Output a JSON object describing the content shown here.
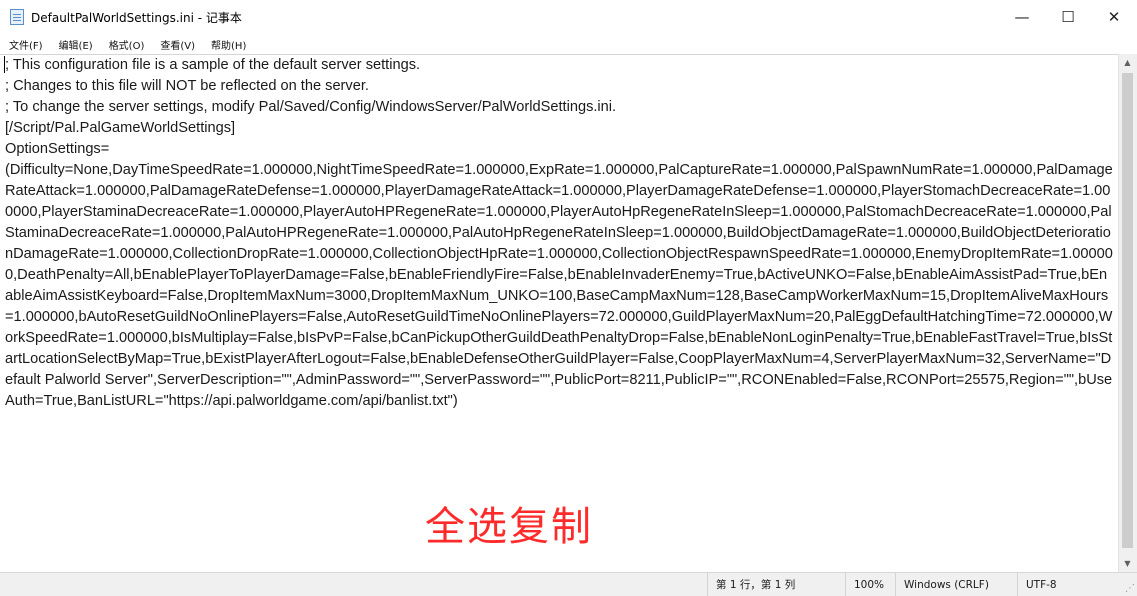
{
  "window": {
    "title": "DefaultPalWorldSettings.ini - 记事本",
    "app_icon": "notepad-icon",
    "controls": {
      "minimize": "—",
      "maximize": "☐",
      "close": "✕"
    }
  },
  "menu": {
    "items": [
      "文件(F)",
      "编辑(E)",
      "格式(O)",
      "查看(V)",
      "帮助(H)"
    ]
  },
  "editor": {
    "content": "; This configuration file is a sample of the default server settings.\n; Changes to this file will NOT be reflected on the server.\n; To change the server settings, modify Pal/Saved/Config/WindowsServer/PalWorldSettings.ini.\n[/Script/Pal.PalGameWorldSettings]\nOptionSettings=\n(Difficulty=None,DayTimeSpeedRate=1.000000,NightTimeSpeedRate=1.000000,ExpRate=1.000000,PalCaptureRate=1.000000,PalSpawnNumRate=1.000000,PalDamageRateAttack=1.000000,PalDamageRateDefense=1.000000,PlayerDamageRateAttack=1.000000,PlayerDamageRateDefense=1.000000,PlayerStomachDecreaceRate=1.000000,PlayerStaminaDecreaceRate=1.000000,PlayerAutoHPRegeneRate=1.000000,PlayerAutoHpRegeneRateInSleep=1.000000,PalStomachDecreaceRate=1.000000,PalStaminaDecreaceRate=1.000000,PalAutoHPRegeneRate=1.000000,PalAutoHpRegeneRateInSleep=1.000000,BuildObjectDamageRate=1.000000,BuildObjectDeteriorationDamageRate=1.000000,CollectionDropRate=1.000000,CollectionObjectHpRate=1.000000,CollectionObjectRespawnSpeedRate=1.000000,EnemyDropItemRate=1.000000,DeathPenalty=All,bEnablePlayerToPlayerDamage=False,bEnableFriendlyFire=False,bEnableInvaderEnemy=True,bActiveUNKO=False,bEnableAimAssistPad=True,bEnableAimAssistKeyboard=False,DropItemMaxNum=3000,DropItemMaxNum_UNKO=100,BaseCampMaxNum=128,BaseCampWorkerMaxNum=15,DropItemAliveMaxHours=1.000000,bAutoResetGuildNoOnlinePlayers=False,AutoResetGuildTimeNoOnlinePlayers=72.000000,GuildPlayerMaxNum=20,PalEggDefaultHatchingTime=72.000000,WorkSpeedRate=1.000000,bIsMultiplay=False,bIsPvP=False,bCanPickupOtherGuildDeathPenaltyDrop=False,bEnableNonLoginPenalty=True,bEnableFastTravel=True,bIsStartLocationSelectByMap=True,bExistPlayerAfterLogout=False,bEnableDefenseOtherGuildPlayer=False,CoopPlayerMaxNum=4,ServerPlayerMaxNum=32,ServerName=\"Default Palworld Server\",ServerDescription=\"\",AdminPassword=\"\",ServerPassword=\"\",PublicPort=8211,PublicIP=\"\",RCONEnabled=False,RCONPort=25575,Region=\"\",bUseAuth=True,BanListURL=\"https://api.palworldgame.com/api/banlist.txt\")"
  },
  "overlay": {
    "caption": "全选复制",
    "color": "#ff2a2a"
  },
  "status": {
    "position": "第 1 行，第 1 列",
    "zoom": "100%",
    "line_ending": "Windows (CRLF)",
    "encoding": "UTF-8"
  }
}
